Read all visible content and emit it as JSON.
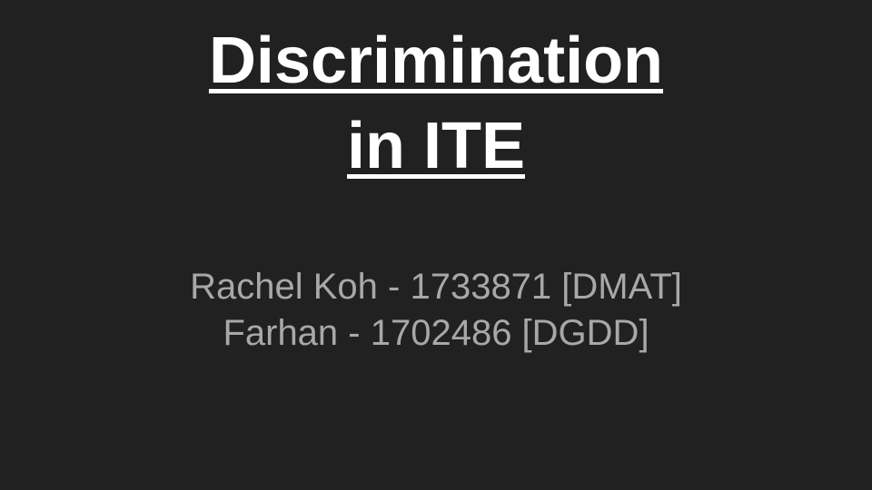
{
  "slide": {
    "title_line1": "Discrimination",
    "title_line2": "in ITE",
    "subtitle_line1": "Rachel Koh - 1733871 [DMAT]",
    "subtitle_line2": "Farhan - 1702486 [DGDD]"
  },
  "colors": {
    "background": "#212121",
    "title": "#ffffff",
    "subtitle": "#a8a8a8"
  }
}
